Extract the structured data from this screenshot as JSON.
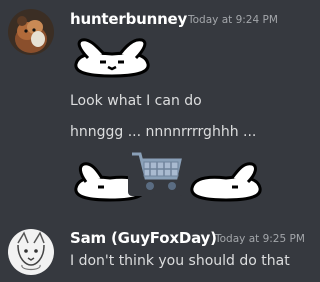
{
  "messages": [
    {
      "username": "hunterbunney",
      "timestamp": "Today at 9:24 PM",
      "lines": [
        "Look what I can do",
        "hnnggg ... nnnnrrrrghhh ..."
      ],
      "avatar_icon": "cat-avatar-icon"
    },
    {
      "username": "Sam (GuyFoxDay)",
      "timestamp": "Today at 9:25 PM",
      "lines": [
        "I don't think you should do that"
      ],
      "avatar_icon": "fox-sketch-avatar-icon"
    }
  ],
  "emojis": {
    "top": "bunny-emoji",
    "bottom": [
      "bunny-left-half-emoji",
      "shopping-cart-emoji",
      "bunny-right-half-emoji"
    ]
  },
  "colors": {
    "background": "#36393f",
    "username": "#ffffff",
    "timestamp": "#a3a6aa",
    "text": "#dcddde"
  }
}
